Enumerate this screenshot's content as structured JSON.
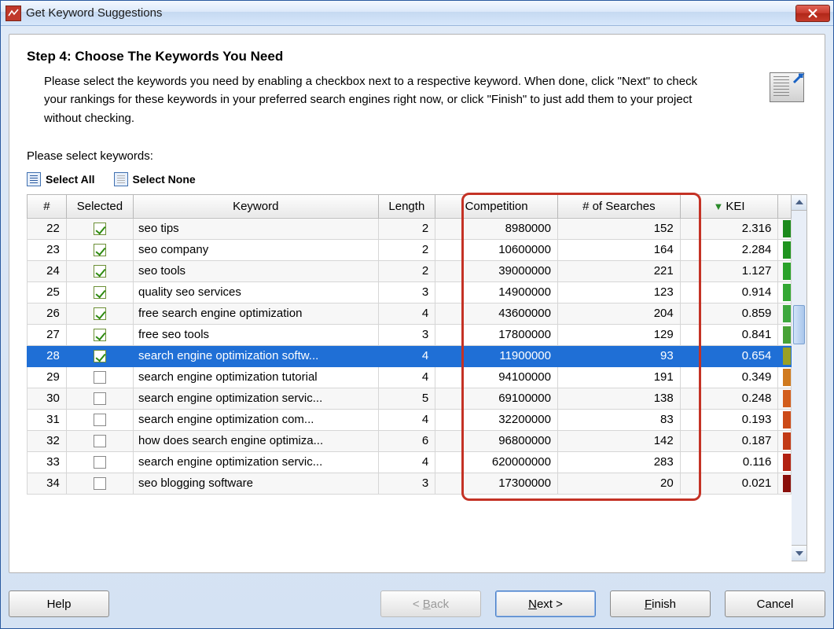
{
  "window": {
    "title": "Get Keyword Suggestions"
  },
  "step": {
    "title": "Step 4: Choose The Keywords You Need",
    "description": "Please select the keywords you need by enabling a checkbox next to a respective keyword. When done, click \"Next\" to check your rankings for these keywords in your preferred search engines right now, or click \"Finish\" to just add them to your project without checking."
  },
  "selectLabel": "Please select keywords:",
  "actions": {
    "selectAll": "Select All",
    "selectNone": "Select None"
  },
  "columns": {
    "idx": "#",
    "selected": "Selected",
    "keyword": "Keyword",
    "length": "Length",
    "competition": "Competition",
    "searches": "# of Searches",
    "kei": "KEI"
  },
  "rows": [
    {
      "idx": 22,
      "checked": true,
      "keyword": "seo tips",
      "length": 2,
      "competition": "8980000",
      "searches": "152",
      "kei": "2.316",
      "color": "#1b8a1b"
    },
    {
      "idx": 23,
      "checked": true,
      "keyword": "seo company",
      "length": 2,
      "competition": "10600000",
      "searches": "164",
      "kei": "2.284",
      "color": "#1f941f"
    },
    {
      "idx": 24,
      "checked": true,
      "keyword": "seo tools",
      "length": 2,
      "competition": "39000000",
      "searches": "221",
      "kei": "1.127",
      "color": "#2aa22a"
    },
    {
      "idx": 25,
      "checked": true,
      "keyword": "quality seo services",
      "length": 3,
      "competition": "14900000",
      "searches": "123",
      "kei": "0.914",
      "color": "#34a834"
    },
    {
      "idx": 26,
      "checked": true,
      "keyword": "free search engine optimization",
      "length": 4,
      "competition": "43600000",
      "searches": "204",
      "kei": "0.859",
      "color": "#3da83d"
    },
    {
      "idx": 27,
      "checked": true,
      "keyword": "free seo tools",
      "length": 3,
      "competition": "17800000",
      "searches": "129",
      "kei": "0.841",
      "color": "#47a236"
    },
    {
      "idx": 28,
      "checked": true,
      "keyword": "search engine optimization softw...",
      "length": 4,
      "competition": "11900000",
      "searches": "93",
      "kei": "0.654",
      "color": "#9aa024",
      "selected": true
    },
    {
      "idx": 29,
      "checked": false,
      "keyword": "search engine optimization tutorial",
      "length": 4,
      "competition": "94100000",
      "searches": "191",
      "kei": "0.349",
      "color": "#d07a1e"
    },
    {
      "idx": 30,
      "checked": false,
      "keyword": "search engine optimization servic...",
      "length": 5,
      "competition": "69100000",
      "searches": "138",
      "kei": "0.248",
      "color": "#d25d1c"
    },
    {
      "idx": 31,
      "checked": false,
      "keyword": "search engine optimization com...",
      "length": 4,
      "competition": "32200000",
      "searches": "83",
      "kei": "0.193",
      "color": "#cc4a18"
    },
    {
      "idx": 32,
      "checked": false,
      "keyword": "how does search engine optimiza...",
      "length": 6,
      "competition": "96800000",
      "searches": "142",
      "kei": "0.187",
      "color": "#c23a16"
    },
    {
      "idx": 33,
      "checked": false,
      "keyword": "search engine optimization servic...",
      "length": 4,
      "competition": "620000000",
      "searches": "283",
      "kei": "0.116",
      "color": "#b22212"
    },
    {
      "idx": 34,
      "checked": false,
      "keyword": "seo blogging software",
      "length": 3,
      "competition": "17300000",
      "searches": "20",
      "kei": "0.021",
      "color": "#8a0f0b"
    }
  ],
  "buttons": {
    "help": "Help",
    "back": "< Back",
    "next": "Next >",
    "finish": "Finish",
    "cancel": "Cancel"
  }
}
